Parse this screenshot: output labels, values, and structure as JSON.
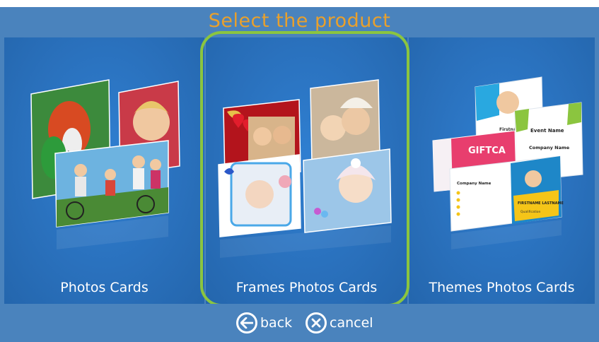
{
  "header": {
    "title": "Select the product"
  },
  "products": [
    {
      "label": "Photos Cards",
      "selected": false
    },
    {
      "label": "Frames Photos Cards",
      "selected": true
    },
    {
      "label": "Themes Photos Cards",
      "selected": false
    }
  ],
  "themes_preview": {
    "name_card": "Firstname",
    "event_card": "Event Name",
    "event_sub": "Company Name",
    "gift_card": "GIFTCA",
    "business_title": "Company Name",
    "business_name": "FIRSTNAME LASTNAME",
    "business_role": "Qualification"
  },
  "footer": {
    "back_label": "back",
    "cancel_label": "cancel"
  },
  "colors": {
    "background": "#4a83bd",
    "panel": "#2a71bd",
    "selection": "#8bc53f",
    "title": "#e9a02c"
  },
  "icons": {
    "back": "back-arrow-icon",
    "cancel": "cancel-x-icon"
  }
}
